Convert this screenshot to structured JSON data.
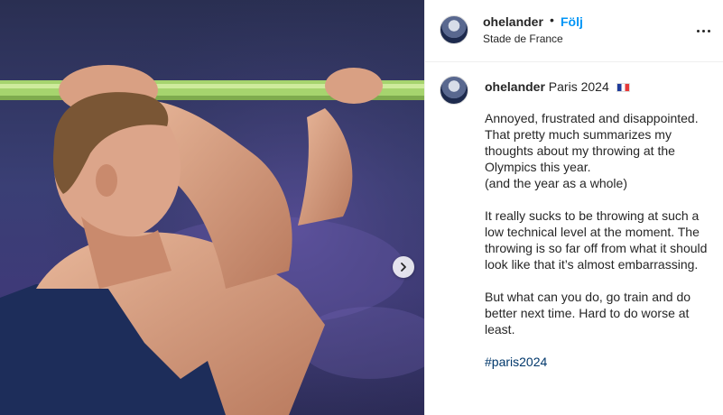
{
  "photo": {
    "alt_icon": "athlete-photo",
    "next_icon": "chevron-right-icon"
  },
  "header": {
    "username": "ohelander",
    "separator": "•",
    "follow_label": "Följ",
    "location": "Stade de France",
    "more_icon": "more-horizontal-icon"
  },
  "caption": {
    "username": "ohelander",
    "title": "Paris 2024",
    "flag_icon": "flag-france-icon",
    "lines": [
      "Annoyed, frustrated and disappointed.",
      "That pretty much summarizes my thoughts about my throwing at the Olympics this year.",
      "(and the year as a whole)"
    ],
    "paragraph2": "It really sucks to be throwing at such a low technical level at the moment. The throwing is so far off from what it should look like that it’s almost embarrassing.",
    "paragraph3": "But what can you do, go train and do better next time. Hard to do worse at least.",
    "hashtag": "#paris2024"
  },
  "colors": {
    "link_blue": "#0095f6",
    "hashtag_blue": "#00376b",
    "text": "#262626",
    "border": "#efefef"
  }
}
